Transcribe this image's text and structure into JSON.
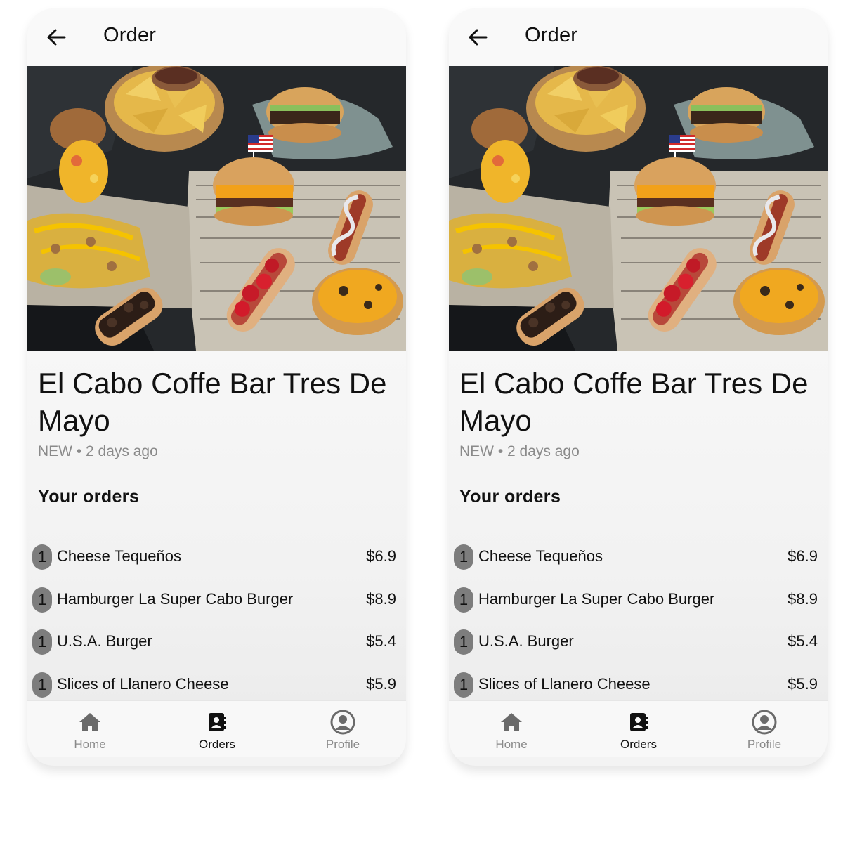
{
  "appbar": {
    "title": "Order",
    "back_icon": "arrow-left-icon"
  },
  "hero": {
    "description_icon": "food-photo"
  },
  "restaurant": {
    "name": "El Cabo Coffe Bar Tres De Mayo",
    "status": "NEW",
    "time": "2 days ago",
    "meta": "NEW • 2 days ago"
  },
  "orders": {
    "section_title": "Your orders",
    "items": [
      {
        "qty": "1",
        "name": "Cheese Tequeños",
        "price": "$6.9"
      },
      {
        "qty": "1",
        "name": "Hamburger La Super Cabo Burger",
        "price": "$8.9"
      },
      {
        "qty": "1",
        "name": "U.S.A. Burger",
        "price": "$5.4"
      },
      {
        "qty": "1",
        "name": "Slices of Llanero Cheese",
        "price": "$5.9"
      }
    ]
  },
  "nav": {
    "home": {
      "label": "Home",
      "icon": "home-icon"
    },
    "orders": {
      "label": "Orders",
      "icon": "orders-icon"
    },
    "profile": {
      "label": "Profile",
      "icon": "profile-icon"
    },
    "active": "orders"
  },
  "colors": {
    "background": "#f3f3f3",
    "badge": "#7d7d7d",
    "text": "#111111",
    "muted": "#8a8a8a"
  }
}
